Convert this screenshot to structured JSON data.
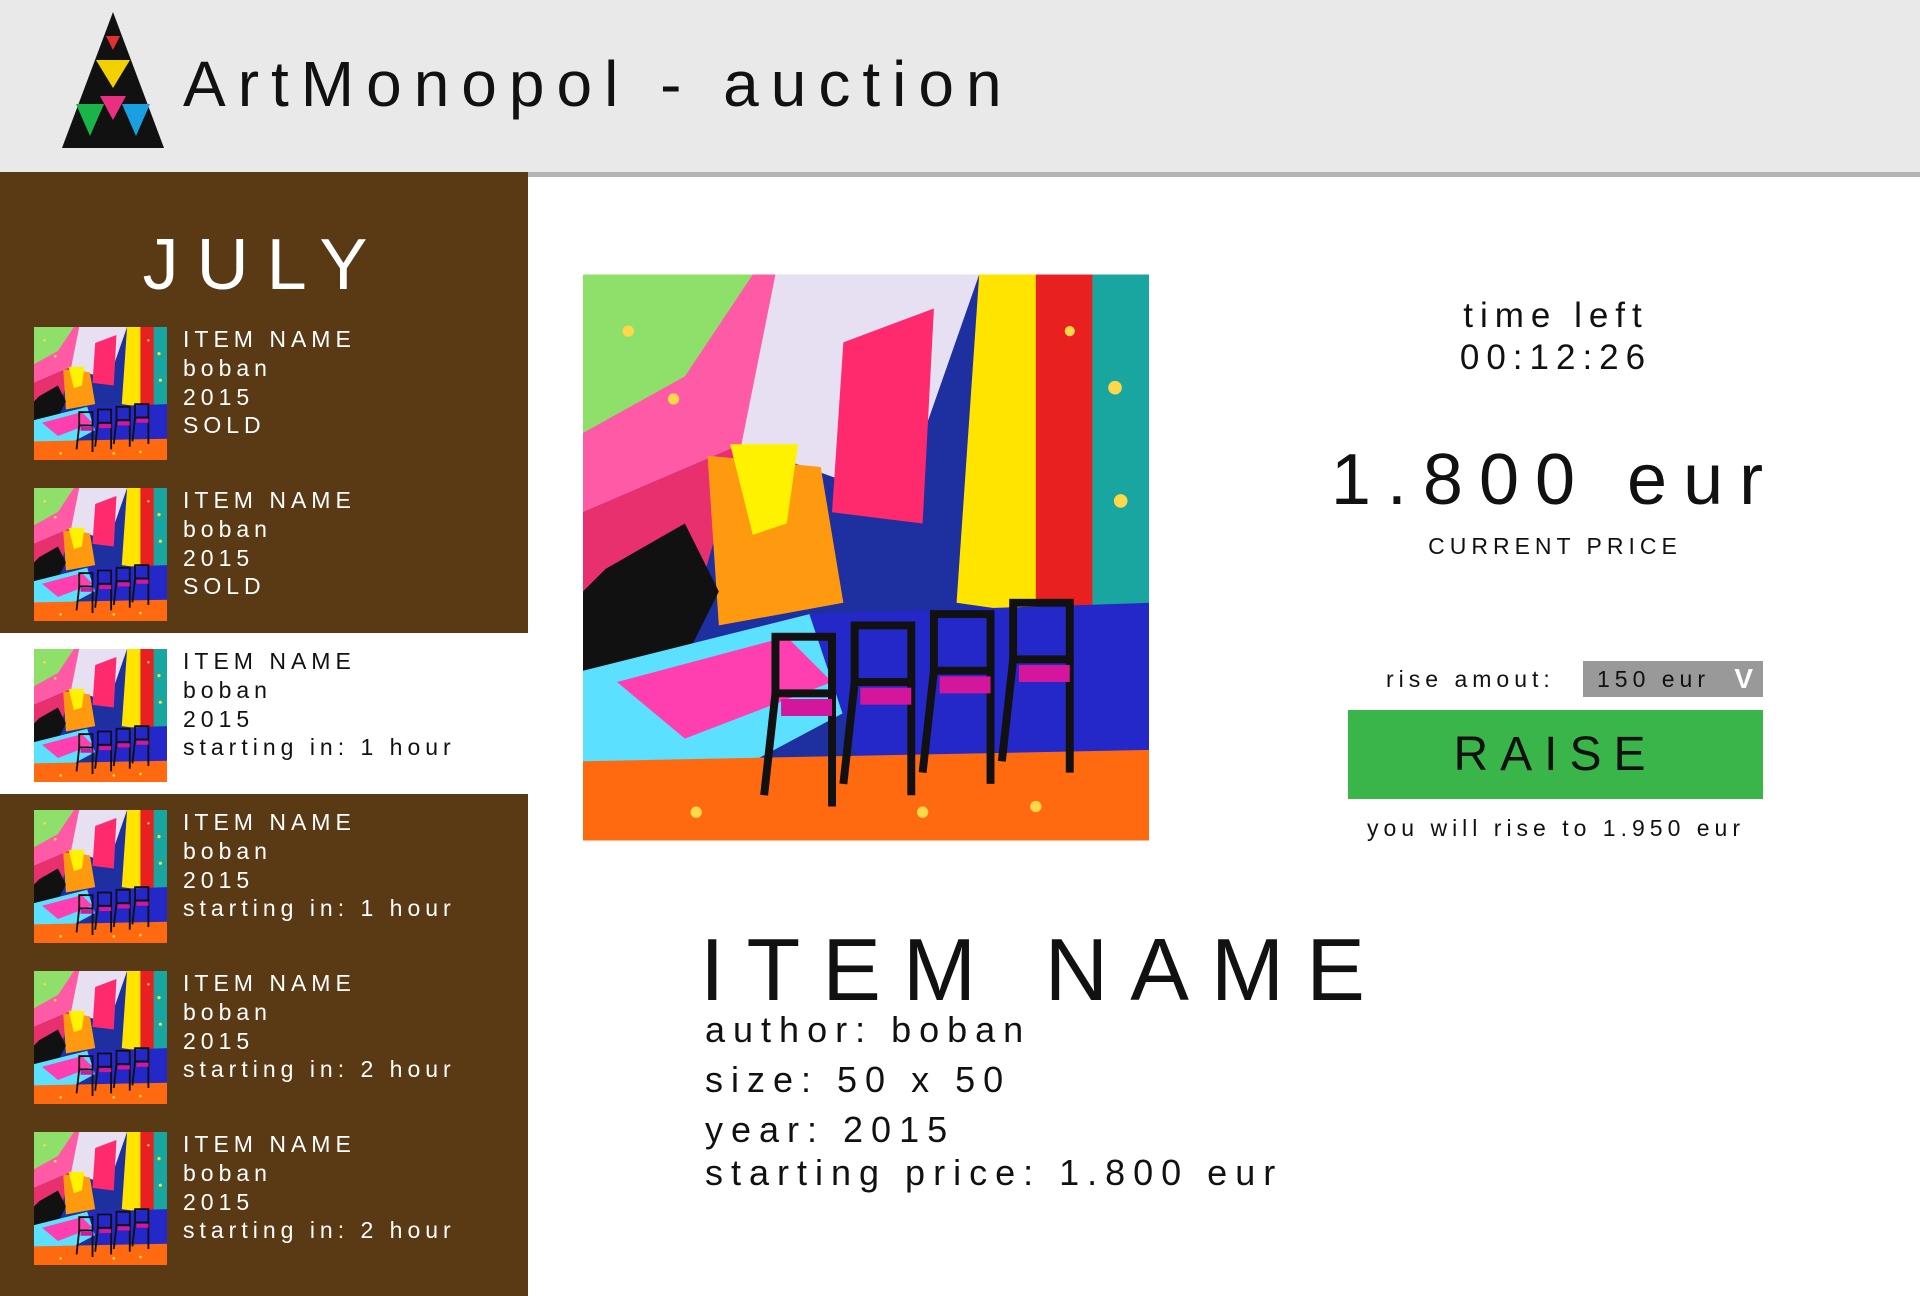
{
  "header": {
    "title": "ArtMonopol - auction"
  },
  "sidebar": {
    "month": "JULY",
    "items": [
      {
        "name": "ITEM NAME",
        "author": "boban",
        "year": "2015",
        "status": "SOLD"
      },
      {
        "name": "ITEM NAME",
        "author": "boban",
        "year": "2015",
        "status": "SOLD"
      },
      {
        "name": "ITEM NAME",
        "author": "boban",
        "year": "2015",
        "status": "starting in: 1 hour"
      },
      {
        "name": "ITEM NAME",
        "author": "boban",
        "year": "2015",
        "status": "starting in: 1 hour"
      },
      {
        "name": "ITEM NAME",
        "author": "boban",
        "year": "2015",
        "status": "starting in: 2 hour"
      },
      {
        "name": "ITEM NAME",
        "author": "boban",
        "year": "2015",
        "status": "starting in: 2 hour"
      }
    ]
  },
  "auction": {
    "time_label": "time left",
    "time_value": "00:12:26",
    "price": "1.800 eur",
    "price_caption": "CURRENT PRICE",
    "rise_label": "rise amout:",
    "rise_value": "150 eur",
    "rise_chevron": "V",
    "raise_label": "RAISE",
    "rise_note": "you will rise to 1.950 eur"
  },
  "item": {
    "title": "ITEM NAME",
    "author": "author: boban",
    "size": "size: 50 x 50",
    "year": "year: 2015",
    "starting_price": "starting price: 1.800 eur"
  },
  "colors": {
    "header_bg": "#e9e9ea",
    "sidebar_bg": "#5a3915",
    "raise_button": "#39b54a",
    "rise_select_bg": "#999999"
  }
}
